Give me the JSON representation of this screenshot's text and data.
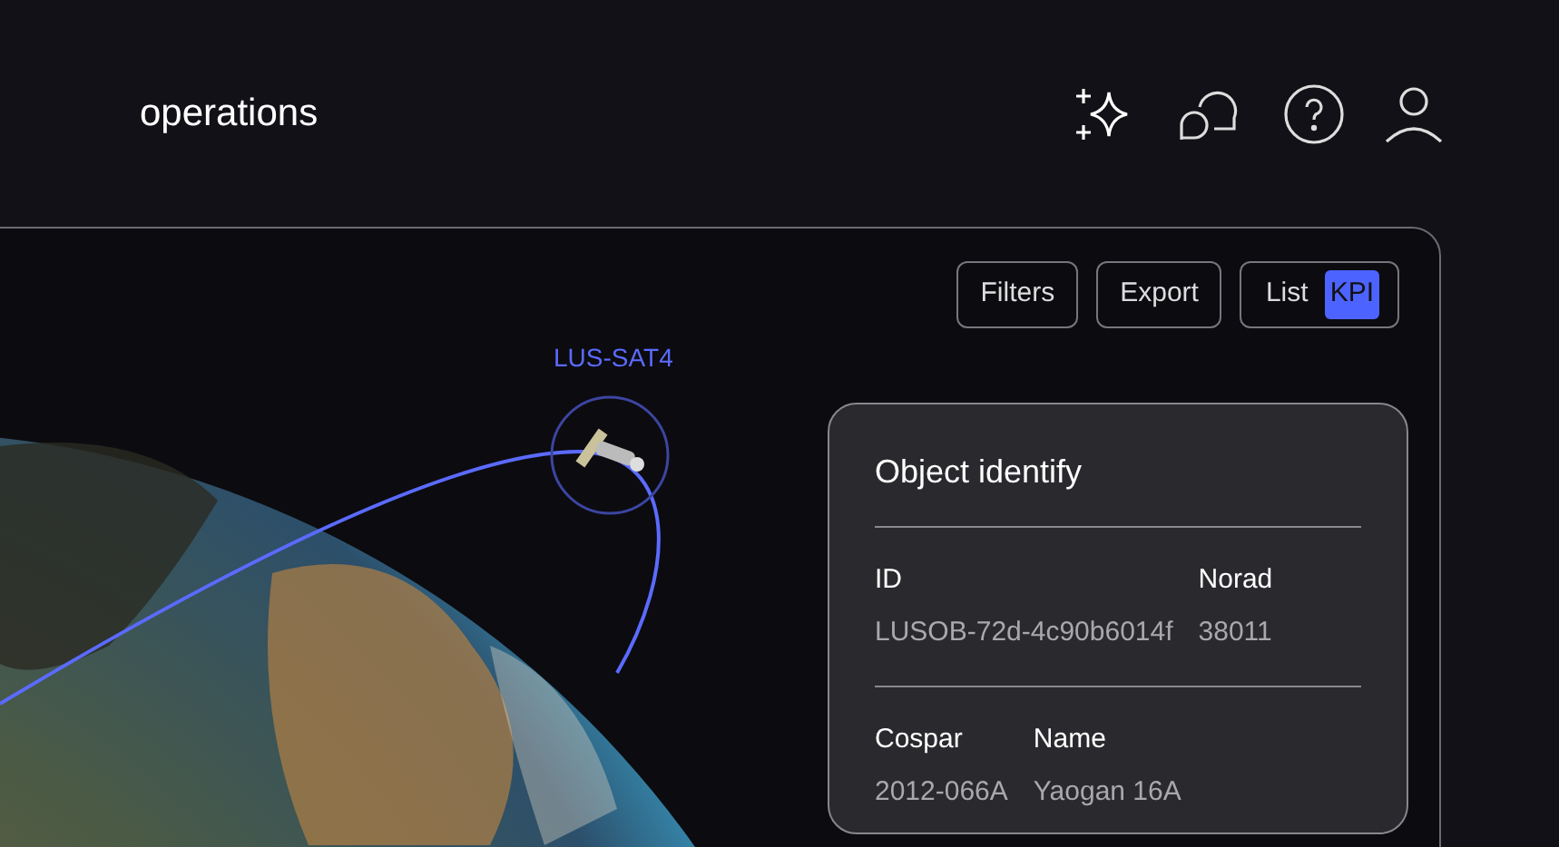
{
  "header": {
    "title": "operations"
  },
  "toolbar": {
    "buttons": [
      {
        "label": "Filters"
      },
      {
        "label": "Export"
      }
    ],
    "view_toggle": [
      {
        "label": "List",
        "selected": false
      },
      {
        "label": "KPI",
        "selected": true
      }
    ]
  },
  "map": {
    "satellite_label": "LUS-SAT4"
  },
  "card": {
    "title": "Object identify",
    "sections": [
      {
        "fields": [
          {
            "label": "ID",
            "value": "LUSOB-72d-4c90b6014f"
          },
          {
            "label": "Norad",
            "value": "38011"
          }
        ]
      },
      {
        "fields": [
          {
            "label": "Cospar",
            "value": "2012-066A"
          },
          {
            "label": "Name",
            "value": "Yaogan 16A"
          }
        ]
      }
    ]
  }
}
